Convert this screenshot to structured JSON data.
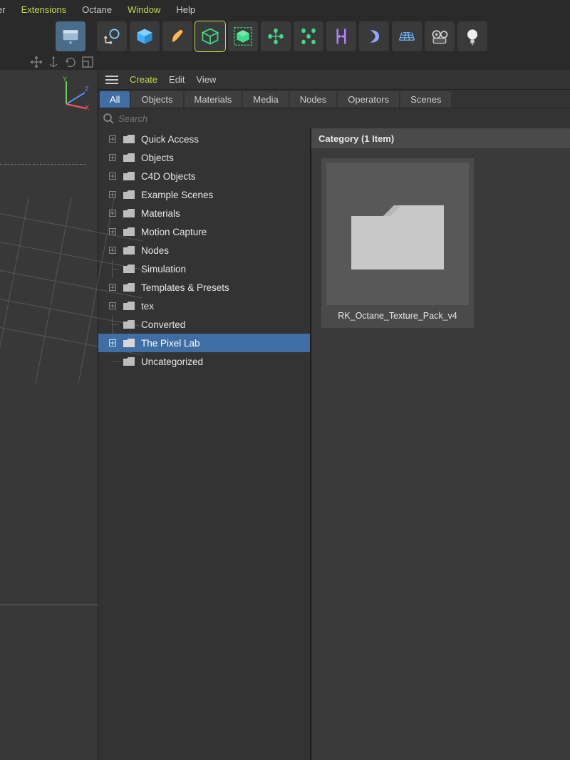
{
  "menubar": {
    "items": [
      {
        "label": "er",
        "highlight": false
      },
      {
        "label": "Extensions",
        "highlight": true
      },
      {
        "label": "Octane",
        "highlight": false
      },
      {
        "label": "Window",
        "highlight": true
      },
      {
        "label": "Help",
        "highlight": false
      }
    ]
  },
  "panel": {
    "header": {
      "create": "Create",
      "edit": "Edit",
      "view": "View"
    },
    "tabs": [
      {
        "label": "All",
        "active": true
      },
      {
        "label": "Objects",
        "active": false
      },
      {
        "label": "Materials",
        "active": false
      },
      {
        "label": "Media",
        "active": false
      },
      {
        "label": "Nodes",
        "active": false
      },
      {
        "label": "Operators",
        "active": false
      },
      {
        "label": "Scenes",
        "active": false
      }
    ],
    "search": {
      "placeholder": "Search"
    },
    "tree": [
      {
        "label": "Quick Access",
        "expandable": true
      },
      {
        "label": "Objects",
        "expandable": true
      },
      {
        "label": "C4D Objects",
        "expandable": true
      },
      {
        "label": "Example Scenes",
        "expandable": true
      },
      {
        "label": "Materials",
        "expandable": true
      },
      {
        "label": "Motion Capture",
        "expandable": true
      },
      {
        "label": "Nodes",
        "expandable": true
      },
      {
        "label": "Simulation",
        "expandable": false
      },
      {
        "label": "Templates & Presets",
        "expandable": true
      },
      {
        "label": "tex",
        "expandable": true
      },
      {
        "label": "Converted",
        "expandable": false
      },
      {
        "label": "The Pixel Lab",
        "expandable": true,
        "selected": true
      },
      {
        "label": "Uncategorized",
        "expandable": false
      }
    ],
    "content": {
      "header": "Category (1 Item)",
      "items": [
        {
          "caption": "RK_Octane_Texture_Pack_v4"
        }
      ]
    }
  }
}
